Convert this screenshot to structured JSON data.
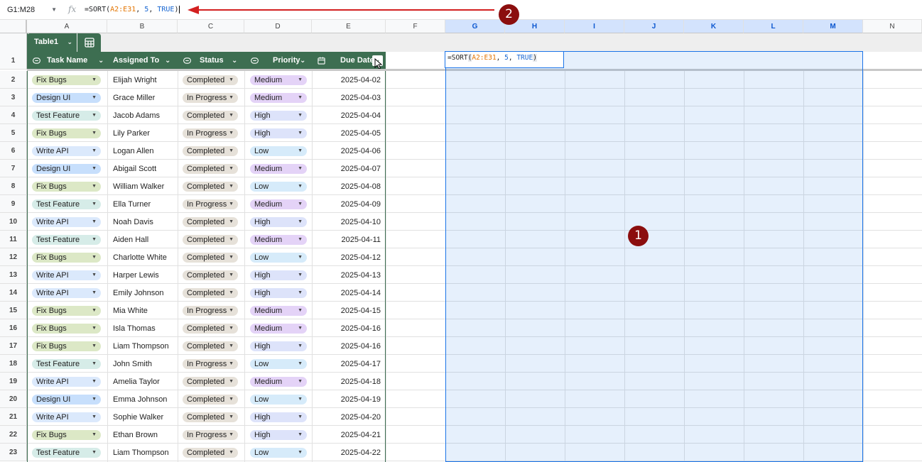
{
  "formula_bar": {
    "name_box": "G1:M28",
    "fx_label": "fx",
    "formula_prefix": "=SORT(",
    "formula_ref": "A2:E31",
    "formula_sep1": ", ",
    "formula_num": "5",
    "formula_sep2": ", ",
    "formula_bool": "TRUE",
    "formula_suffix": ")"
  },
  "columns": [
    "A",
    "B",
    "C",
    "D",
    "E",
    "F",
    "G",
    "H",
    "I",
    "J",
    "K",
    "L",
    "M",
    "N"
  ],
  "table": {
    "name": "Table1",
    "headers": {
      "task": "Task Name",
      "assigned": "Assigned To",
      "status": "Status",
      "priority": "Priority",
      "due": "Due Date"
    }
  },
  "rows": [
    {
      "n": "2",
      "task": "Fix Bugs",
      "who": "Elijah Wright",
      "status": "Completed",
      "priority": "Medium",
      "due": "2025-04-02"
    },
    {
      "n": "3",
      "task": "Design UI",
      "who": "Grace Miller",
      "status": "In Progress",
      "priority": "Medium",
      "due": "2025-04-03"
    },
    {
      "n": "4",
      "task": "Test Feature",
      "who": "Jacob Adams",
      "status": "Completed",
      "priority": "High",
      "due": "2025-04-04"
    },
    {
      "n": "5",
      "task": "Fix Bugs",
      "who": "Lily Parker",
      "status": "In Progress",
      "priority": "High",
      "due": "2025-04-05"
    },
    {
      "n": "6",
      "task": "Write API",
      "who": "Logan Allen",
      "status": "Completed",
      "priority": "Low",
      "due": "2025-04-06"
    },
    {
      "n": "7",
      "task": "Design UI",
      "who": "Abigail Scott",
      "status": "Completed",
      "priority": "Medium",
      "due": "2025-04-07"
    },
    {
      "n": "8",
      "task": "Fix Bugs",
      "who": "William Walker",
      "status": "Completed",
      "priority": "Low",
      "due": "2025-04-08"
    },
    {
      "n": "9",
      "task": "Test Feature",
      "who": "Ella Turner",
      "status": "In Progress",
      "priority": "Medium",
      "due": "2025-04-09"
    },
    {
      "n": "10",
      "task": "Write API",
      "who": "Noah Davis",
      "status": "Completed",
      "priority": "High",
      "due": "2025-04-10"
    },
    {
      "n": "11",
      "task": "Test Feature",
      "who": "Aiden Hall",
      "status": "Completed",
      "priority": "Medium",
      "due": "2025-04-11"
    },
    {
      "n": "12",
      "task": "Fix Bugs",
      "who": "Charlotte White",
      "status": "Completed",
      "priority": "Low",
      "due": "2025-04-12"
    },
    {
      "n": "13",
      "task": "Write API",
      "who": "Harper Lewis",
      "status": "Completed",
      "priority": "High",
      "due": "2025-04-13"
    },
    {
      "n": "14",
      "task": "Write API",
      "who": "Emily Johnson",
      "status": "Completed",
      "priority": "High",
      "due": "2025-04-14"
    },
    {
      "n": "15",
      "task": "Fix Bugs",
      "who": "Mia White",
      "status": "In Progress",
      "priority": "Medium",
      "due": "2025-04-15"
    },
    {
      "n": "16",
      "task": "Fix Bugs",
      "who": "Isla Thomas",
      "status": "Completed",
      "priority": "Medium",
      "due": "2025-04-16"
    },
    {
      "n": "17",
      "task": "Fix Bugs",
      "who": "Liam Thompson",
      "status": "Completed",
      "priority": "High",
      "due": "2025-04-16"
    },
    {
      "n": "18",
      "task": "Test Feature",
      "who": "John Smith",
      "status": "In Progress",
      "priority": "Low",
      "due": "2025-04-17"
    },
    {
      "n": "19",
      "task": "Write API",
      "who": "Amelia Taylor",
      "status": "Completed",
      "priority": "Medium",
      "due": "2025-04-18"
    },
    {
      "n": "20",
      "task": "Design UI",
      "who": "Emma Johnson",
      "status": "Completed",
      "priority": "Low",
      "due": "2025-04-19"
    },
    {
      "n": "21",
      "task": "Write API",
      "who": "Sophie Walker",
      "status": "Completed",
      "priority": "High",
      "due": "2025-04-20"
    },
    {
      "n": "22",
      "task": "Fix Bugs",
      "who": "Ethan Brown",
      "status": "In Progress",
      "priority": "High",
      "due": "2025-04-21"
    },
    {
      "n": "23",
      "task": "Test Feature",
      "who": "Liam Thompson",
      "status": "Completed",
      "priority": "Low",
      "due": "2025-04-22"
    }
  ],
  "editing_cell": {
    "prefix": "=SORT",
    "open": "(",
    "ref": "A2:E31",
    "sep1": ", ",
    "num": "5",
    "sep2": ", ",
    "bool": "TRUE",
    "close": ")"
  },
  "annotations": {
    "badge1": "1",
    "badge2": "2"
  },
  "colors": {
    "table_header": "#3d6e51",
    "selection": "#1a73e8",
    "annotation": "#8b0e0e",
    "task_chips": {
      "Fix Bugs": "#dce8c6",
      "Design UI": "#c7dffc",
      "Test Feature": "#d6ece8",
      "Write API": "#dbe9fc"
    },
    "status_chip": "#e6e1d9",
    "priority_chips": {
      "Medium": "#e4d3f7",
      "High": "#dde3fa",
      "Low": "#d6ebfa"
    }
  }
}
